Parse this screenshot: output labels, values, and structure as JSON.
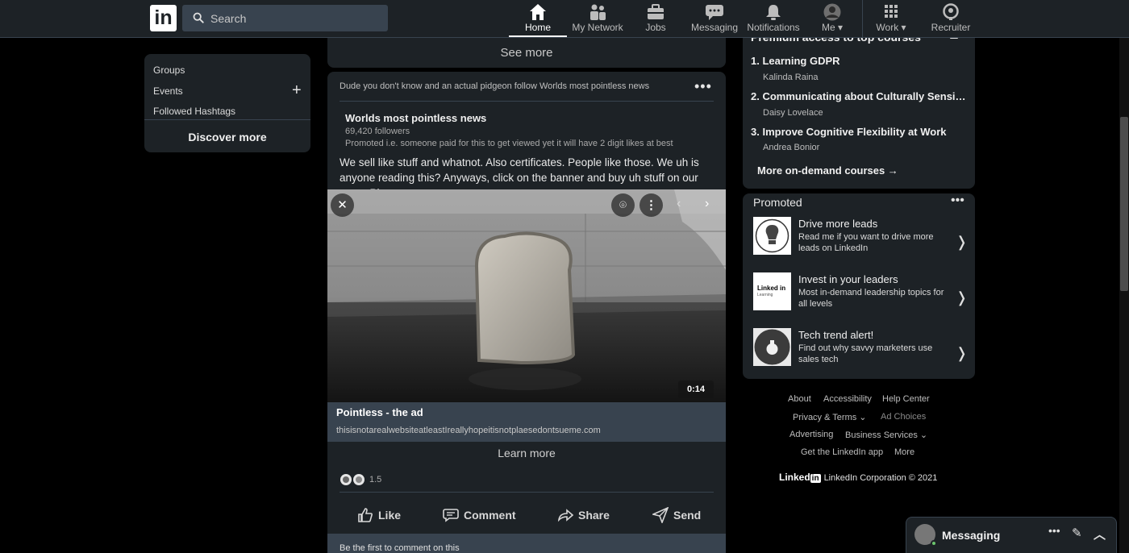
{
  "nav": {
    "logo_text": "in",
    "search_placeholder": "Search",
    "items": [
      {
        "label": "Home",
        "icon": "home-icon"
      },
      {
        "label": "My Network",
        "icon": "network-icon"
      },
      {
        "label": "Jobs",
        "icon": "briefcase-icon"
      },
      {
        "label": "Messaging",
        "icon": "chat-icon"
      },
      {
        "label": "Notifications",
        "icon": "bell-icon"
      },
      {
        "label": "Me",
        "icon": "avatar-icon"
      },
      {
        "label": "Work",
        "icon": "grid-icon"
      },
      {
        "label": "Recruiter",
        "icon": "recruiter-icon"
      }
    ]
  },
  "left": {
    "groups": "Groups",
    "events": "Events",
    "hashtags": "Followed Hashtags",
    "discover": "Discover more"
  },
  "feed": {
    "see_more": "See more",
    "post": {
      "context": "Dude you don't know and an actual pidgeon follow Worlds most pointless news",
      "author": "Worlds most pointless news",
      "followers": "69,420 followers",
      "promoted": "Promoted i.e. someone paid for this to get viewed yet it will have 2 digit likes at best",
      "text": "We sell like stuff and whatnot. Also certificates. People like those. We uh is anyone reading this? Anyways, click on the banner and buy uh stuff on our page. Please.",
      "duration": "0:14",
      "ad_title": "Pointless - the ad",
      "ad_url": "thisisnotarealwebsiteatleastIreallyhopeitisnotplaesedontsueme.com",
      "learn_more": "Learn more",
      "reaction_count": "1.5",
      "actions": {
        "like": "Like",
        "comment": "Comment",
        "share": "Share",
        "send": "Send"
      },
      "comment_prompt": "Be the first to comment on this"
    }
  },
  "right": {
    "courses_title": "Premium access to top courses",
    "courses": [
      {
        "title": "1. Learning GDPR",
        "author": "Kalinda Raina"
      },
      {
        "title": "2. Communicating about Culturally Sensi…",
        "author": "Daisy Lovelace"
      },
      {
        "title": "3. Improve Cognitive Flexibility at Work",
        "author": "Andrea Bonior"
      }
    ],
    "more_courses": "More on-demand courses →",
    "promoted_title": "Promoted",
    "promos": [
      {
        "head": "Drive more leads",
        "desc": "Read me if you want to drive more leads on LinkedIn"
      },
      {
        "head": "Invest in your leaders",
        "desc": "Most in-demand leadership topics for all levels"
      },
      {
        "head": "Tech trend alert!",
        "desc": "Find out why savvy marketers use sales tech"
      }
    ],
    "promo_thumb_text": "Linked in",
    "promo_thumb_sub": "Learning"
  },
  "footer": {
    "about": "About",
    "accessibility": "Accessibility",
    "help": "Help Center",
    "privacy": "Privacy & Terms ⌄",
    "adchoices": "Ad Choices",
    "advertising": "Advertising",
    "business": "Business Services ⌄",
    "getapp": "Get the LinkedIn app",
    "more": "More",
    "brand": "Linked",
    "brand_in": "in",
    "copyright": "LinkedIn Corporation © 2021"
  },
  "messaging": {
    "title": "Messaging"
  },
  "colors": {
    "nav_bg": "#1d2226",
    "card_bg": "#1d2226",
    "divider": "#38434f",
    "page_bg": "#000000"
  }
}
